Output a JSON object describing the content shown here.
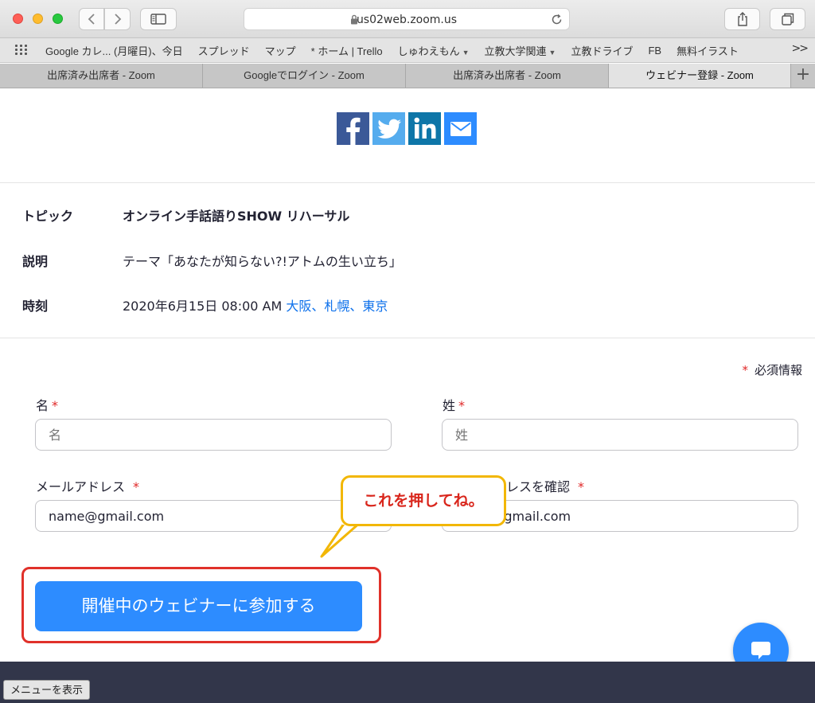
{
  "browser": {
    "url": "us02web.zoom.us",
    "bookmarks": [
      {
        "label": "Google カレ... (月曜日)、今日",
        "dropdown": false
      },
      {
        "label": "スプレッド",
        "dropdown": false
      },
      {
        "label": "マップ",
        "dropdown": false
      },
      {
        "label": "* ホーム | Trello",
        "dropdown": false
      },
      {
        "label": "しゅわえもん",
        "dropdown": true
      },
      {
        "label": "立教大学関連",
        "dropdown": true
      },
      {
        "label": "立教ドライブ",
        "dropdown": false
      },
      {
        "label": "FB",
        "dropdown": false
      },
      {
        "label": "無料イラスト",
        "dropdown": false
      }
    ],
    "bookmarks_more": ">>",
    "tabs": [
      {
        "label": "出席済み出席者 - Zoom",
        "active": false
      },
      {
        "label": "Googleでログイン - Zoom",
        "active": false
      },
      {
        "label": "出席済み出席者 - Zoom",
        "active": false
      },
      {
        "label": "ウェビナー登録 - Zoom",
        "active": true
      }
    ],
    "tab_add": "+"
  },
  "share_icons": [
    "facebook-icon",
    "twitter-icon",
    "linkedin-icon",
    "email-icon"
  ],
  "info": {
    "topic_label": "トピック",
    "topic_value": "オンライン手話語りSHOW リハーサル",
    "description_label": "説明",
    "description_value": "テーマ「あなたが知らない?!アトムの生い立ち」",
    "time_label": "時刻",
    "time_value": "2020年6月15日 08:00 AM",
    "time_zone": "大阪、札幌、東京"
  },
  "form": {
    "required_star": "*",
    "required_note": "必須情報",
    "first_name_label": "名",
    "first_name_placeholder": "名",
    "last_name_label": "姓",
    "last_name_placeholder": "姓",
    "email_label": "メールアドレス",
    "email_value": "name@gmail.com",
    "confirm_email_label": "ドレスを確認",
    "confirm_email_value": "name@gmail.com",
    "join_button": "開催中のウェビナーに参加する"
  },
  "annotation": {
    "bubble_text": "これを押してね。",
    "bubble_border_color": "#f2b705",
    "highlight_color": "#e0312a"
  },
  "footer": {
    "menu_toggle": "メニューを表示"
  },
  "colors": {
    "accent": "#2d8cff",
    "footer_bg": "#32364a",
    "link": "#0e71eb"
  }
}
